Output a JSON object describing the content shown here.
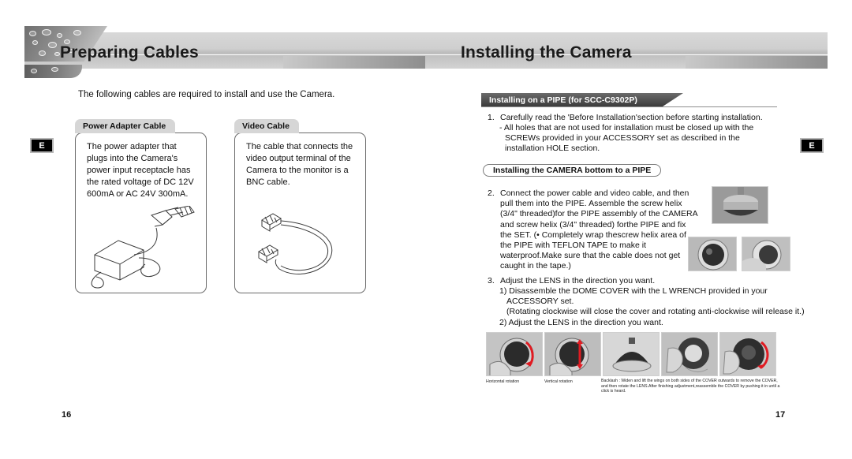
{
  "document": {
    "left_page": {
      "header_title": "Preparing Cables",
      "side_tab": "E",
      "page_number": "16",
      "intro": "The following cables are required to install and use the Camera.",
      "cards": [
        {
          "tab_label": "Power Adapter Cable",
          "body": "The power adapter that plugs into the Camera's power input receptacle has the rated voltage of DC 12V 600mA or AC 24V 300mA.",
          "illustration": "power-adapter-illustration"
        },
        {
          "tab_label": "Video Cable",
          "body": "The cable that connects the video output terminal of the Camera to the monitor is a BNC cable.",
          "illustration": "bnc-cable-illustration"
        }
      ]
    },
    "right_page": {
      "header_title": "Installing the Camera",
      "side_tab": "E",
      "page_number": "17",
      "section_title": "Installing on a PIPE (for SCC-C9302P)",
      "step1": {
        "number": "1.",
        "text": "Carefully read the 'Before Installation'section before starting installation.",
        "bullet": "- All holes that are not used for installation must be closed up with the SCREWs provided in your ACCESSORY set as described in the installation HOLE section."
      },
      "subsection_title": "Installing the CAMERA bottom to a PIPE",
      "step2": {
        "number": "2.",
        "text": "Connect the power cable and video cable, and then pull them into the PIPE. Assemble the screw helix (3/4\" threaded)for the PIPE assembly of the CAMERA and screw helix (3/4\" threaded) forthe PIPE and fix the SET. (• Completely wrap thescrew helix area of the PIPE with TEFLON TAPE to make it waterproof.Make sure that the cable does not get caught in the tape.)"
      },
      "step3": {
        "number": "3.",
        "text": "Adjust the LENS in the direction you want.",
        "sub1": "1) Disassemble the DOME COVER with the L WRENCH provided in your ACCESSORY set.",
        "note": "(Rotating clockwise will close the cover and rotating anti-clockwise will release it.)",
        "sub2": "2) Adjust the LENS in the direction you want."
      },
      "photos_top": [
        {
          "name": "camera-on-pipe-photo"
        },
        {
          "name": "dome-camera-front-photo"
        },
        {
          "name": "dome-camera-hand-photo"
        }
      ],
      "photos_bottom": [
        {
          "name": "horizontal-rotation-photo",
          "caption": "Horizontal rotation"
        },
        {
          "name": "vertical-rotation-photo",
          "caption": "Vertical rotation"
        },
        {
          "name": "dome-cover-photo",
          "caption": ""
        },
        {
          "name": "cover-removal-photo",
          "caption": ""
        },
        {
          "name": "backlash-adjust-photo",
          "caption": ""
        }
      ],
      "backlash_caption": "Backlash : Widen and lift the wings on both sides of the COVER outwards to remove the COVER, and then rotate the LENS.After finishing adjustment,reassemble the COVER by pushing it in until a click is heard."
    }
  },
  "colors": {
    "band": "#cfcfcf",
    "tab_dark": "#3b3b3b",
    "arrow_red": "#e01b22",
    "card_tab": "#d6d6d6"
  }
}
